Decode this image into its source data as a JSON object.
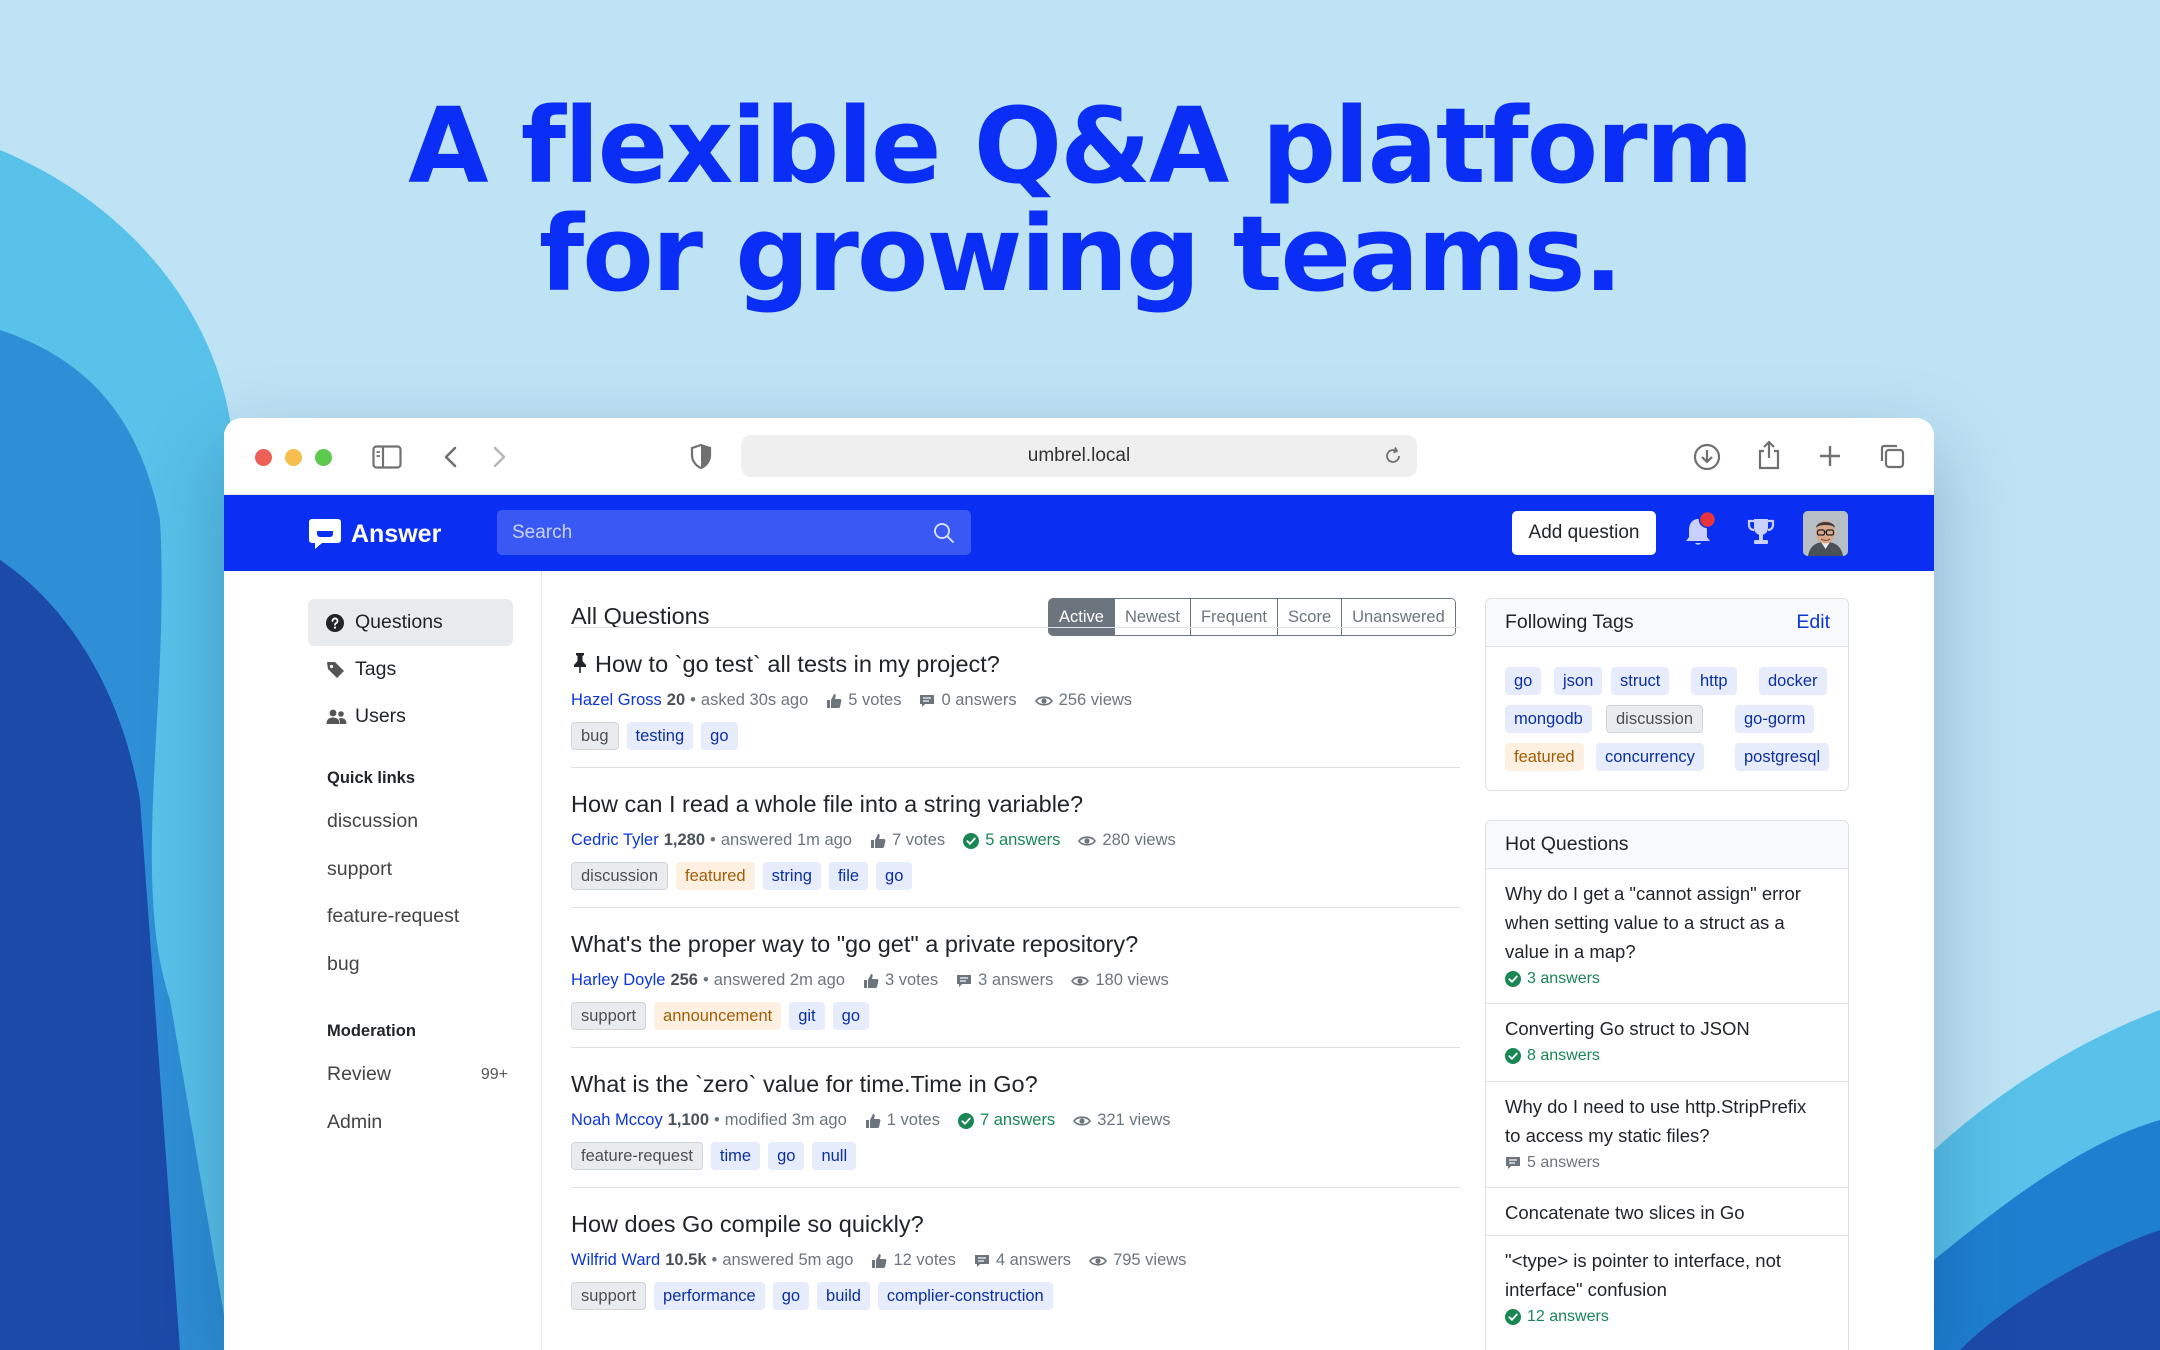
{
  "hero": {
    "line1": "A flexible Q&A platform",
    "line2": "for growing teams."
  },
  "browser": {
    "url": "umbrel.local"
  },
  "navbar": {
    "brand": "Answer",
    "search_placeholder": "Search",
    "add_question": "Add question"
  },
  "sidebar": {
    "nav": [
      {
        "label": "Questions",
        "icon": "question-circle-icon",
        "active": true
      },
      {
        "label": "Tags",
        "icon": "tag-icon"
      },
      {
        "label": "Users",
        "icon": "users-icon"
      }
    ],
    "quick_links_heading": "Quick links",
    "quick_links": [
      "discussion",
      "support",
      "feature-request",
      "bug"
    ],
    "moderation_heading": "Moderation",
    "moderation": [
      {
        "label": "Review",
        "badge": "99+"
      },
      {
        "label": "Admin",
        "badge": ""
      }
    ]
  },
  "main": {
    "title": "All Questions",
    "tabs": [
      "Active",
      "Newest",
      "Frequent",
      "Score",
      "Unanswered"
    ],
    "active_tab": "Active",
    "questions": [
      {
        "title": "How to `go test` all tests in my project?",
        "pinned": true,
        "user": "Hazel Gross",
        "rep": "20",
        "action": "asked 30s ago",
        "votes": "5 votes",
        "answers": "0 answers",
        "accepted": false,
        "views": "256 views",
        "tags": [
          {
            "label": "bug",
            "kind": "reserved"
          },
          {
            "label": "testing",
            "kind": "normal"
          },
          {
            "label": "go",
            "kind": "normal"
          }
        ]
      },
      {
        "title": "How can I read a whole file into a string variable?",
        "pinned": false,
        "user": "Cedric Tyler",
        "rep": "1,280",
        "action": "answered 1m ago",
        "votes": "7 votes",
        "answers": "5 answers",
        "accepted": true,
        "views": "280 views",
        "tags": [
          {
            "label": "discussion",
            "kind": "reserved"
          },
          {
            "label": "featured",
            "kind": "recommend"
          },
          {
            "label": "string",
            "kind": "normal"
          },
          {
            "label": "file",
            "kind": "normal"
          },
          {
            "label": "go",
            "kind": "normal"
          }
        ]
      },
      {
        "title": "What's the proper way to \"go get\" a private repository?",
        "pinned": false,
        "user": "Harley Doyle",
        "rep": "256",
        "action": "answered 2m ago",
        "votes": "3 votes",
        "answers": "3 answers",
        "accepted": false,
        "views": "180 views",
        "tags": [
          {
            "label": "support",
            "kind": "reserved"
          },
          {
            "label": "announcement",
            "kind": "recommend"
          },
          {
            "label": "git",
            "kind": "normal"
          },
          {
            "label": "go",
            "kind": "normal"
          }
        ]
      },
      {
        "title": "What is the `zero` value for time.Time in Go?",
        "pinned": false,
        "user": "Noah Mccoy",
        "rep": "1,100",
        "action": "modified 3m ago",
        "votes": "1 votes",
        "answers": "7 answers",
        "accepted": true,
        "views": "321 views",
        "tags": [
          {
            "label": "feature-request",
            "kind": "reserved"
          },
          {
            "label": "time",
            "kind": "normal"
          },
          {
            "label": "go",
            "kind": "normal"
          },
          {
            "label": "null",
            "kind": "normal"
          }
        ]
      },
      {
        "title": "How does Go compile so quickly?",
        "pinned": false,
        "user": "Wilfrid Ward",
        "rep": "10.5k",
        "action": "answered 5m ago",
        "votes": "12 votes",
        "answers": "4 answers",
        "accepted": false,
        "views": "795 views",
        "tags": [
          {
            "label": "support",
            "kind": "reserved"
          },
          {
            "label": "performance",
            "kind": "normal"
          },
          {
            "label": "go",
            "kind": "normal"
          },
          {
            "label": "build",
            "kind": "normal"
          },
          {
            "label": "complier-construction",
            "kind": "normal"
          }
        ]
      }
    ]
  },
  "following_tags": {
    "title": "Following Tags",
    "edit": "Edit",
    "rows": [
      [
        {
          "label": "go",
          "kind": "normal"
        },
        {
          "label": "json",
          "kind": "normal"
        },
        {
          "label": "struct",
          "kind": "normal"
        },
        {
          "label": "http",
          "kind": "normal"
        },
        {
          "label": "docker",
          "kind": "normal"
        }
      ],
      [
        {
          "label": "mongodb",
          "kind": "normal"
        },
        {
          "label": "discussion",
          "kind": "reserved"
        },
        {
          "label": "go-gorm",
          "kind": "normal"
        }
      ],
      [
        {
          "label": "featured",
          "kind": "recommend"
        },
        {
          "label": "concurrency",
          "kind": "normal"
        },
        {
          "label": "postgresql",
          "kind": "normal"
        }
      ]
    ]
  },
  "hot_questions": {
    "title": "Hot Questions",
    "items": [
      {
        "title": "Why do I get a \"cannot assign\" error when setting value to a struct as a value in a map?",
        "answers": "3 answers",
        "accepted": true
      },
      {
        "title": "Converting Go struct to JSON",
        "answers": "8 answers",
        "accepted": true
      },
      {
        "title": "Why do I need to use http.StripPrefix to access my static files?",
        "answers": "5 answers",
        "accepted": false
      },
      {
        "title": "Concatenate two slices in Go",
        "answers": "",
        "accepted": false
      },
      {
        "title": "\"<type> is pointer to interface, not interface\" confusion",
        "answers": "12 answers",
        "accepted": true
      }
    ]
  },
  "colors": {
    "brand": "#0b2ff2",
    "headline": "#0a2ef5",
    "link": "#0b36d9",
    "accepted": "#198754",
    "notification": "#e8333b"
  }
}
